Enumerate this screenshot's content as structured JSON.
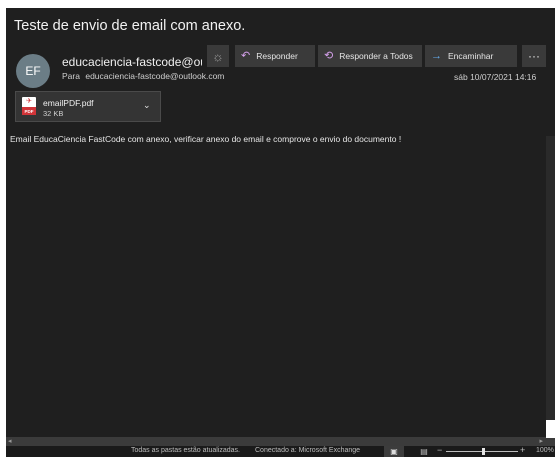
{
  "email": {
    "subject": "Teste de envio de email com anexo.",
    "avatar_initials": "EF",
    "sender": "educaciencia-fastcode@outlo",
    "to_label": "Para",
    "to_address": "educaciencia-fastcode@outlook.com",
    "date": "sáb 10/07/2021 14:16",
    "body": "Email EducaCiencia FastCode com anexo, verificar anexo do email e comprove o envio do documento !"
  },
  "toolbar": {
    "sun_icon": "sun-icon",
    "reply_label": "Responder",
    "reply_all_label": "Responder a Todos",
    "forward_label": "Encaminhar",
    "more_label": "···"
  },
  "attachment": {
    "name": "emailPDF.pdf",
    "size": "32 KB",
    "icon": "pdf-file-icon",
    "pdf_badge": "PDF"
  },
  "status_bar": {
    "sync_status": "Todas as pastas estão atualizadas.",
    "connection": "Conectado a: Microsoft Exchange",
    "zoom": "100%"
  },
  "colors": {
    "background": "#1f1f1f",
    "button": "#3a3a3a",
    "reply_icon": "#d7a2ee",
    "forward_icon": "#66aef0",
    "pdf_red": "#d13438"
  }
}
